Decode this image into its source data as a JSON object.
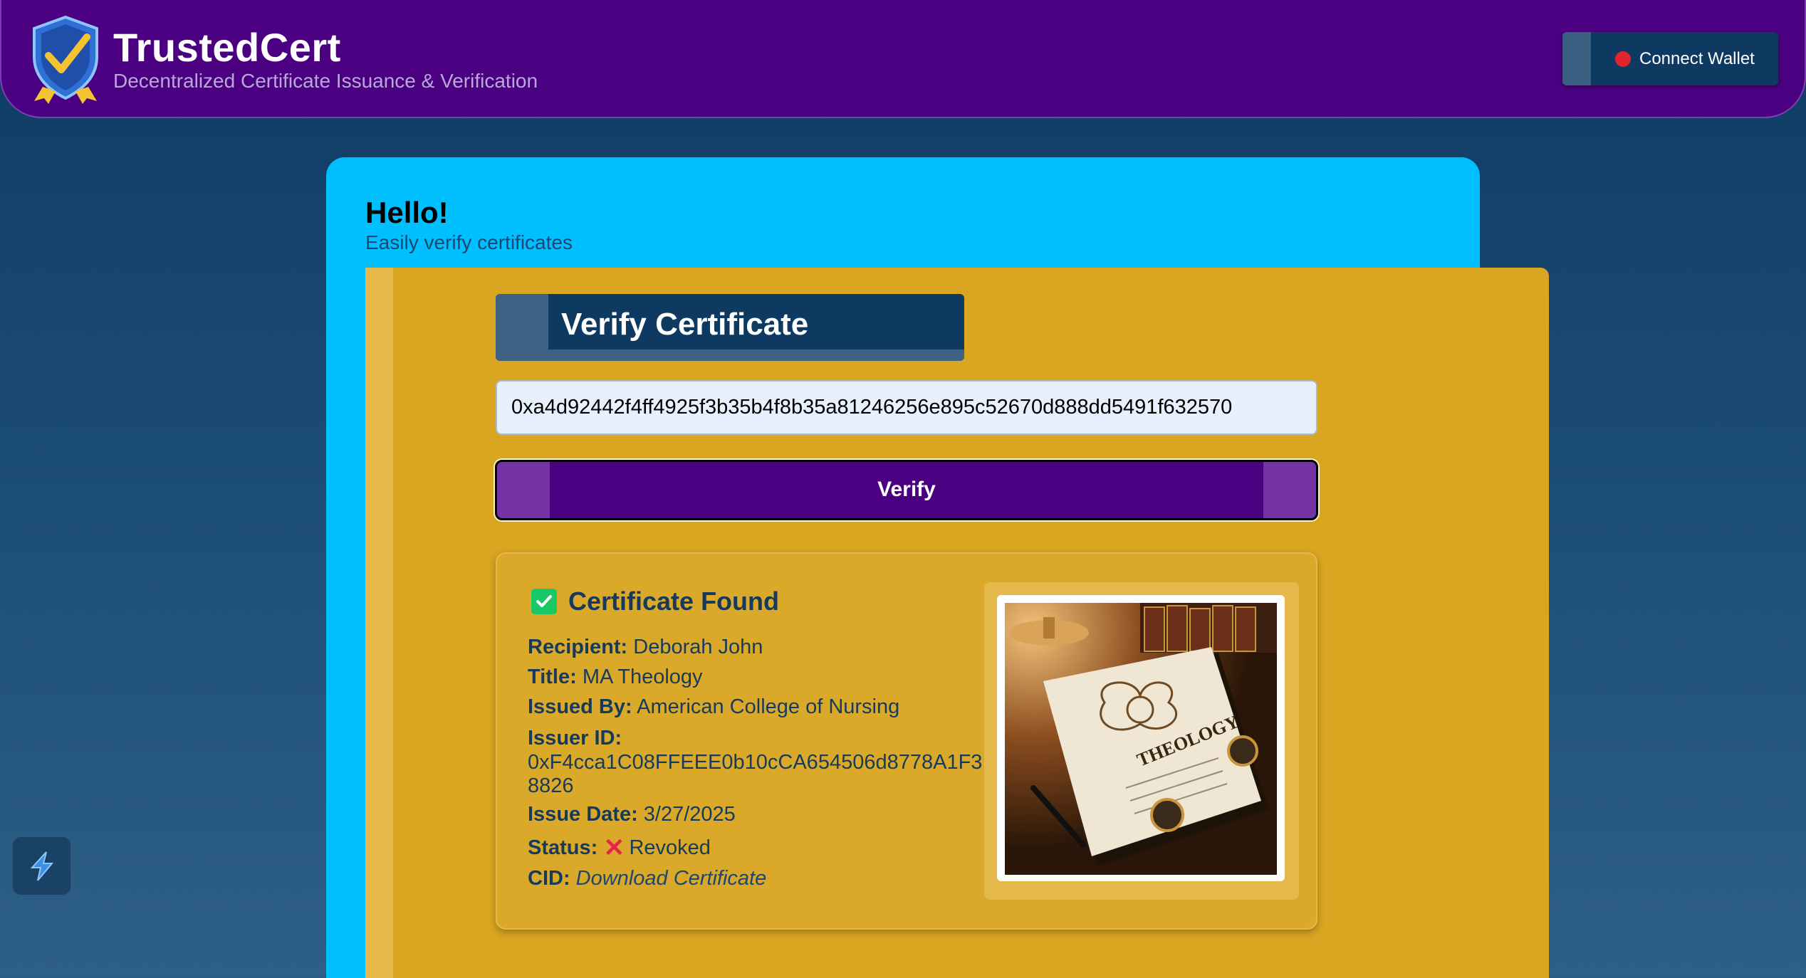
{
  "header": {
    "title": "TrustedCert",
    "subtitle": "Decentralized Certificate Issuance & Verification",
    "connect_wallet_label": "Connect Wallet",
    "logo_icon": "shield-check-icon"
  },
  "main": {
    "greeting": "Hello!",
    "greeting_sub": "Easily verify certificates",
    "section_title": "Verify Certificate",
    "hash_input_value": "0xa4d92442f4ff4925f3b35b4f8b35a81246256e895c52670d888dd5491f632570",
    "verify_button_label": "Verify"
  },
  "result": {
    "heading": "Certificate Found",
    "recipient_label": "Recipient:",
    "recipient": "Deborah John",
    "title_label": "Title:",
    "title": "MA Theology",
    "issued_by_label": "Issued By:",
    "issued_by": "American College of Nursing",
    "issuer_id_label": "Issuer ID:",
    "issuer_id": "0xF4cca1C08FFEEE0b10cCA654506d8778A1F38826",
    "issue_date_label": "Issue Date:",
    "issue_date": "3/27/2025",
    "status_label": "Status:",
    "status": "Revoked",
    "cid_label": "CID:",
    "cid_link": "Download Certificate",
    "certificate_image_text": "THEOLOGY"
  },
  "colors": {
    "header_bg": "#4b0082",
    "panel_bg": "#00bfff",
    "card_bg": "#daa520",
    "navy": "#0e3a62",
    "status_revoked": "#e8234a",
    "found_check": "#17c964",
    "wallet_dot": "#e0262a"
  }
}
